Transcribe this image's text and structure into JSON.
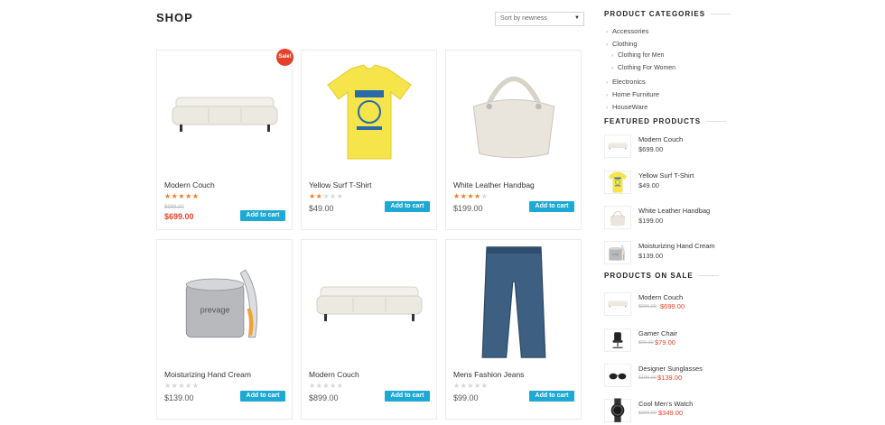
{
  "page": {
    "title": "SHOP"
  },
  "sort": {
    "selected": "Sort by newness"
  },
  "products": [
    {
      "name": "Modern Couch",
      "stars": 5,
      "old_price": "$999.00",
      "price": "$699.00",
      "sale": true,
      "badge": "Sale!",
      "cart": "Add to cart",
      "image": "sofa"
    },
    {
      "name": "Yellow Surf T-Shirt",
      "stars": 2,
      "price": "$49.00",
      "sale": false,
      "cart": "Add to cart",
      "image": "tshirt"
    },
    {
      "name": "White Leather Handbag",
      "stars": 4,
      "price": "$199.00",
      "sale": false,
      "cart": "Add to cart",
      "image": "handbag"
    },
    {
      "name": "Moisturizing Hand Cream",
      "stars": 0,
      "price": "$139.00",
      "sale": false,
      "cart": "Add to cart",
      "image": "cream"
    },
    {
      "name": "Modern Couch",
      "stars": 0,
      "price": "$899.00",
      "sale": false,
      "cart": "Add to cart",
      "image": "sofa"
    },
    {
      "name": "Mens Fashion Jeans",
      "stars": 0,
      "price": "$99.00",
      "sale": false,
      "cart": "Add to cart",
      "image": "jeans"
    }
  ],
  "categories": {
    "heading": "PRODUCT CATEGORIES",
    "items": [
      "Accessories",
      "Clothing",
      "Clothing for Men",
      "Clothing For Women",
      "Electronics",
      "Home Furniture",
      "HouseWare"
    ]
  },
  "featured": {
    "heading": "FEATURED PRODUCTS",
    "items": [
      {
        "name": "Modern Couch",
        "price": "$699.00",
        "image": "sofa"
      },
      {
        "name": "Yellow Surf T-Shirt",
        "price": "$49.00",
        "image": "tshirt"
      },
      {
        "name": "White Leather Handbag",
        "price": "$199.00",
        "image": "handbag"
      },
      {
        "name": "Moisturizing Hand Cream",
        "price": "$139.00",
        "image": "cream"
      }
    ]
  },
  "on_sale": {
    "heading": "PRODUCTS ON SALE",
    "items": [
      {
        "name": "Modern Couch",
        "old_price": "$999.00",
        "price": "$699.00",
        "image": "sofa"
      },
      {
        "name": "Gamer Chair",
        "old_price": "$99.00",
        "price": "$79.00",
        "image": "chair"
      },
      {
        "name": "Designer Sunglasses",
        "old_price": "$199.00",
        "price": "$139.00",
        "image": "sunglasses"
      },
      {
        "name": "Cool Men's Watch",
        "old_price": "$399.00",
        "price": "$349.00",
        "image": "watch"
      }
    ]
  },
  "colors": {
    "accent": "#1ca9d4",
    "sale": "#e5412a",
    "star": "#f47a20"
  }
}
